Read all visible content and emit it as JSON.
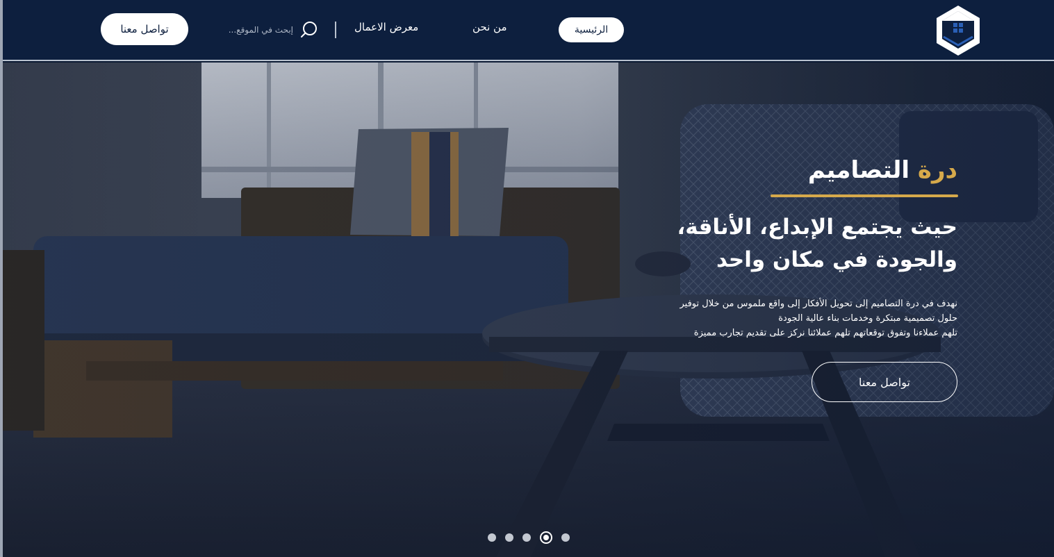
{
  "header": {
    "contact_button": "تواصل معنا",
    "search_placeholder": "إبحث في الموقع...",
    "nav": {
      "gallery": "معرض الاعمال",
      "about": "من نحن",
      "home": "الرئيسية"
    }
  },
  "hero": {
    "title_accent": "درة",
    "title_rest": "التصاميم",
    "headline_line1": "حيث يجتمع الإبداع، الأناقة،",
    "headline_line2": "والجودة في مكان واحد",
    "desc_line1": "نهدف في درة التصاميم إلى تحويل الأفكار إلى واقع ملموس من خلال توفير",
    "desc_line2": "حلول تصميمية مبتكرة وخدمات بناء عالية الجودة",
    "desc_line3": "تلهم عملاءنا وتفوق توقعاتهم تلهم عملائنا نركز على تقديم تجارب مميزة",
    "cta": "تواصل معنا"
  },
  "slider": {
    "count": 5,
    "active_index": 3
  },
  "colors": {
    "navy": "#0d1f3e",
    "gold": "#d6a94b",
    "white": "#ffffff"
  },
  "icons": {
    "search": "search-icon",
    "logo": "house-logo-icon"
  }
}
